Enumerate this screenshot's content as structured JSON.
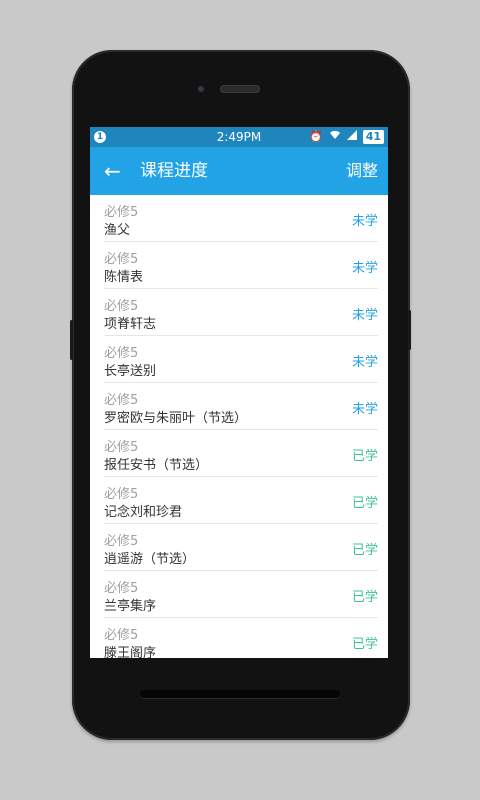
{
  "status_bar": {
    "notification_count": "1",
    "time": "2:49PM",
    "battery": "41",
    "icons": [
      "alarm-icon",
      "wifi-icon",
      "signal-icon",
      "battery-icon"
    ]
  },
  "toolbar": {
    "title": "课程进度",
    "action_label": "调整"
  },
  "colors": {
    "status_bar": "#1e86bd",
    "toolbar": "#22a3e6",
    "not_learned": "#22a3e6",
    "learned": "#3cc48f"
  },
  "lessons": [
    {
      "category": "必修5",
      "name": "渔父",
      "status": "未学",
      "state": "not_learned"
    },
    {
      "category": "必修5",
      "name": "陈情表",
      "status": "未学",
      "state": "not_learned"
    },
    {
      "category": "必修5",
      "name": "项脊轩志",
      "status": "未学",
      "state": "not_learned"
    },
    {
      "category": "必修5",
      "name": "长亭送别",
      "status": "未学",
      "state": "not_learned"
    },
    {
      "category": "必修5",
      "name": "罗密欧与朱丽叶（节选）",
      "status": "未学",
      "state": "not_learned"
    },
    {
      "category": "必修5",
      "name": "报任安书（节选）",
      "status": "已学",
      "state": "learned"
    },
    {
      "category": "必修5",
      "name": "记念刘和珍君",
      "status": "已学",
      "state": "learned"
    },
    {
      "category": "必修5",
      "name": "逍遥游（节选）",
      "status": "已学",
      "state": "learned"
    },
    {
      "category": "必修5",
      "name": "兰亭集序",
      "status": "已学",
      "state": "learned"
    },
    {
      "category": "必修5",
      "name": "滕王阁序",
      "status": "已学",
      "state": "learned"
    }
  ]
}
